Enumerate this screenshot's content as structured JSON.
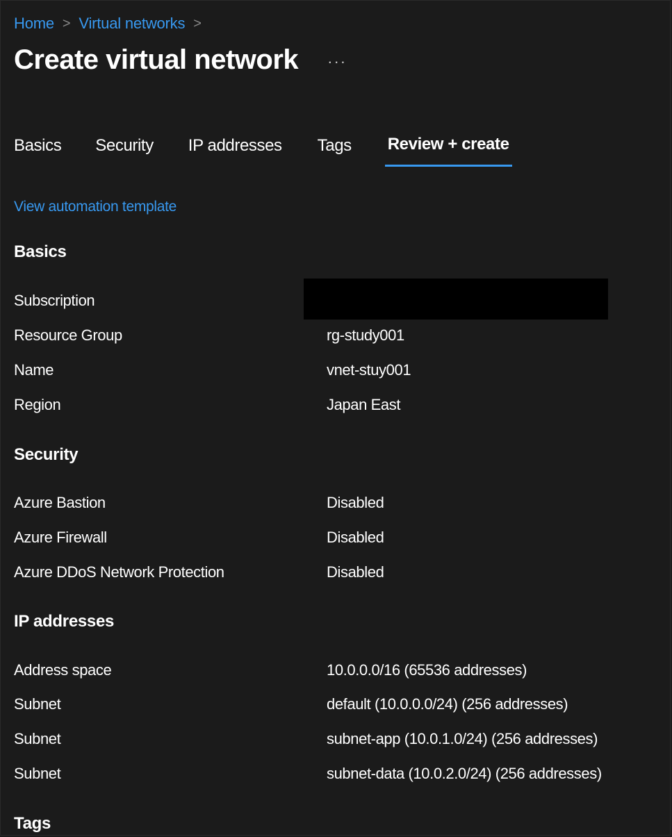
{
  "breadcrumb": {
    "items": [
      "Home",
      "Virtual networks"
    ],
    "separator": ">"
  },
  "header": {
    "title": "Create virtual network",
    "more_label": "···"
  },
  "tabs": [
    {
      "label": "Basics",
      "active": false
    },
    {
      "label": "Security",
      "active": false
    },
    {
      "label": "IP addresses",
      "active": false
    },
    {
      "label": "Tags",
      "active": false
    },
    {
      "label": "Review + create",
      "active": true
    }
  ],
  "automation_link": "View automation template",
  "sections": {
    "basics": {
      "heading": "Basics",
      "rows": [
        {
          "label": "Subscription",
          "value": ""
        },
        {
          "label": "Resource Group",
          "value": "rg-study001"
        },
        {
          "label": "Name",
          "value": "vnet-stuy001"
        },
        {
          "label": "Region",
          "value": "Japan East"
        }
      ]
    },
    "security": {
      "heading": "Security",
      "rows": [
        {
          "label": "Azure Bastion",
          "value": "Disabled"
        },
        {
          "label": "Azure Firewall",
          "value": "Disabled"
        },
        {
          "label": "Azure DDoS Network Protection",
          "value": "Disabled"
        }
      ]
    },
    "ip": {
      "heading": "IP addresses",
      "rows": [
        {
          "label": "Address space",
          "value": "10.0.0.0/16 (65536 addresses)"
        },
        {
          "label": "Subnet",
          "value": "default (10.0.0.0/24) (256 addresses)"
        },
        {
          "label": "Subnet",
          "value": "subnet-app (10.0.1.0/24) (256 addresses)"
        },
        {
          "label": "Subnet",
          "value": "subnet-data (10.0.2.0/24) (256 addresses)"
        }
      ]
    },
    "tags": {
      "heading": "Tags"
    }
  },
  "colors": {
    "background": "#1b1b1b",
    "accent": "#3899f0",
    "text": "#ffffff"
  }
}
